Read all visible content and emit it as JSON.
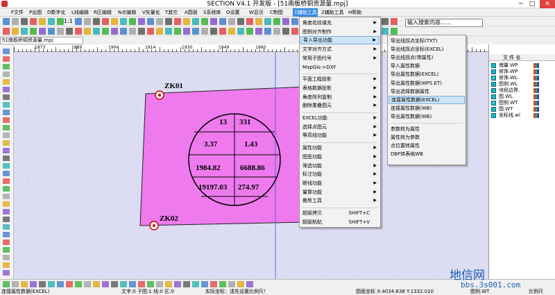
{
  "window": {
    "title": "SECTION V4.1 开发版 - [51南板桥铜资源量.mpj]"
  },
  "menubar": [
    {
      "label": "F文件",
      "active": false
    },
    {
      "label": "P出图",
      "active": false
    },
    {
      "label": "D数字化",
      "active": false
    },
    {
      "label": "L线编辑",
      "active": false
    },
    {
      "label": "R区编辑",
      "active": false
    },
    {
      "label": "N点编辑",
      "active": false
    },
    {
      "label": "V矢量化",
      "active": false
    },
    {
      "label": "T其它",
      "active": false
    },
    {
      "label": "A图层",
      "active": false
    },
    {
      "label": "S系统库",
      "active": false
    },
    {
      "label": "O设置",
      "active": false
    },
    {
      "label": "W显示",
      "active": false
    },
    {
      "label": "C制图",
      "active": false
    },
    {
      "label": "1辅助工具",
      "active": true
    },
    {
      "label": "2辅助工具",
      "active": false
    },
    {
      "label": "H帮助",
      "active": false
    }
  ],
  "toolbar": {
    "zoom_label": "1:1",
    "search_value": "输入搜索内容......"
  },
  "doc_tab": "51南板桥铜资源量.mpj",
  "ruler": {
    "ticks": [
      "1873",
      "1889",
      "1904",
      "1914",
      "1930",
      "1949",
      "1960"
    ]
  },
  "canvas": {
    "points": [
      "ZK01",
      "ZK02"
    ],
    "circle_values": [
      "13",
      "331",
      "3.37",
      "1.43",
      "1984.82",
      "6688.86",
      "19197.03",
      "274.97"
    ]
  },
  "right_panel": {
    "header": "文 件 名",
    "files": [
      {
        "name": "储量.WP",
        "checked": false
      },
      {
        "name": "修饰.WP",
        "checked": false
      },
      {
        "name": "修饰.WL",
        "checked": true
      },
      {
        "name": "图例.WL",
        "checked": false
      },
      {
        "name": "块段边界.",
        "checked": false
      },
      {
        "name": "图.WL",
        "checked": false
      },
      {
        "name": "图例.WT",
        "checked": true
      },
      {
        "name": "图.WT",
        "checked": false
      },
      {
        "name": "坐标线.wl",
        "checked": false
      }
    ]
  },
  "menu1": {
    "items": [
      {
        "label": "角度花纹填充",
        "arrow": true
      },
      {
        "label": "图例对齐制作",
        "arrow": true
      },
      {
        "label": "导入导出功能",
        "arrow": true,
        "highlight": true
      },
      {
        "label": "文字对齐方式",
        "arrow": true
      },
      {
        "label": "常用子图代号",
        "arrow": true
      },
      {
        "label": "MapGis->DXF",
        "arrow": false
      },
      {
        "sep": true
      },
      {
        "label": "平面工程投影",
        "arrow": true
      },
      {
        "label": "表格数据投影",
        "arrow": true
      },
      {
        "label": "角度阵列复制",
        "arrow": true
      },
      {
        "label": "删除重叠图元",
        "arrow": true
      },
      {
        "sep": true
      },
      {
        "label": "EXCEL功能",
        "arrow": true
      },
      {
        "label": "选择点图元",
        "arrow": true
      },
      {
        "label": "等高线功能",
        "arrow": true
      },
      {
        "sep": true
      },
      {
        "label": "属性功能",
        "arrow": true
      },
      {
        "label": "图签功能",
        "arrow": true
      },
      {
        "label": "筛选功能",
        "arrow": true
      },
      {
        "label": "标注功能",
        "arrow": true
      },
      {
        "label": "断线功能",
        "arrow": true
      },
      {
        "label": "量算功能",
        "arrow": true
      },
      {
        "label": "裁剪工具",
        "arrow": true
      },
      {
        "sep": true
      },
      {
        "label": "超级拷贝",
        "shortcut": "SHIFT+C"
      },
      {
        "label": "超级粘贴",
        "shortcut": "SHIFT+V"
      }
    ]
  },
  "menu2": {
    "items": [
      {
        "label": "导出线拐点坐标(TXT)"
      },
      {
        "label": "导出线拐点坐标(EXCEL)"
      },
      {
        "label": "导出线拐点(带属性)"
      },
      {
        "label": "导入属性数据"
      },
      {
        "label": "导出属性数据(EXCEL)"
      },
      {
        "label": "导出属性数据(WPS ET)"
      },
      {
        "label": "导出选择数据属性"
      },
      {
        "label": "连接属性数据(EXCEL)",
        "highlight": true
      },
      {
        "label": "连接属性数据(WB)"
      },
      {
        "label": "导出属性数据(WB)"
      },
      {
        "sep": true
      },
      {
        "label": "参数转为属性"
      },
      {
        "label": "属性转为参数"
      },
      {
        "label": "点位置转属性"
      },
      {
        "label": "DBF转表格WB"
      }
    ]
  },
  "status": {
    "left": "连接属性数据(EXCEL)",
    "sub": "文字:0 子图:1 线:0 区:0",
    "coords_label": "实际坐标：请先设置比例尺！",
    "map_coords": "图面坐标 X:4034.638 Y:1332.010",
    "layer": "图例.WT",
    "scale_label": "比例尺"
  },
  "watermark": {
    "text": "地信网",
    "site": "bbs.3s001.com"
  }
}
